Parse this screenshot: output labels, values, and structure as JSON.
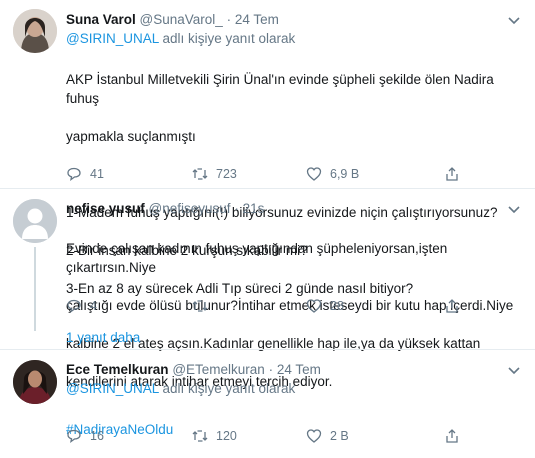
{
  "tweets": [
    {
      "name": "Suna Varol",
      "handle": "@SunaVarol_",
      "sep": "·",
      "time": "24 Tem",
      "reply_user": "@SIRIN_UNAL",
      "reply_suffix": "adlı kişiye yanıt olarak",
      "lines": [
        "AKP İstanbul Milletvekili Şirin Ünal'ın evinde şüpheli şekilde ölen Nadira fuhuş",
        "yapmakla suçlanmıştı",
        "",
        "1-Madem fuhuş yaptığını(!) biliyorsunuz evinizde niçin çalıştırıyorsunuz?",
        "2-Bir insan kalbine 2 kurşun sıkabilir mi?",
        "3-En az 8 ay sürecek Adli Tıp süreci 2 günde nasıl bitiyor?"
      ],
      "replies": "41",
      "retweets": "723",
      "likes": "6,9 B",
      "avatar_icon": "woman-portrait-icon"
    },
    {
      "name": "nefise yusuf",
      "handle": "@nefiseyusuf",
      "sep": "·",
      "time": "21s",
      "lines": [
        "Evinde çalışan kadının fuhuş yaptığından şüpheleniyorsan,işten çıkartırsın.Niye",
        "çalıştığı evde ölüsü bulunur?İntihar etmek isteseydi bir kutu hap içerdi.Niye",
        "kalbine 2 el ateş açsın.Kadınlar genellikle hap ile,ya da yüksek kattan",
        "kendilerini atarak intihar  etmeyi tercih ediyor."
      ],
      "replies": "4",
      "retweets": "",
      "likes": "28",
      "more_replies": "1 yanıt daha",
      "avatar_icon": "default-user-icon"
    },
    {
      "name": "Ece Temelkuran",
      "handle": "@ETemelkuran",
      "sep": "·",
      "time": "24 Tem",
      "reply_user": "@SIRIN_UNAL",
      "reply_suffix": "adlı kişiye yanıt olarak",
      "hashtag": "#NadirayaNeOldu",
      "replies": "16",
      "retweets": "120",
      "likes": "2 B",
      "avatar_icon": "woman-portrait-icon"
    }
  ],
  "colors": {
    "accent": "#1b95e0",
    "muted": "#657786",
    "text": "#14171a",
    "divider": "#e6ecf0"
  }
}
